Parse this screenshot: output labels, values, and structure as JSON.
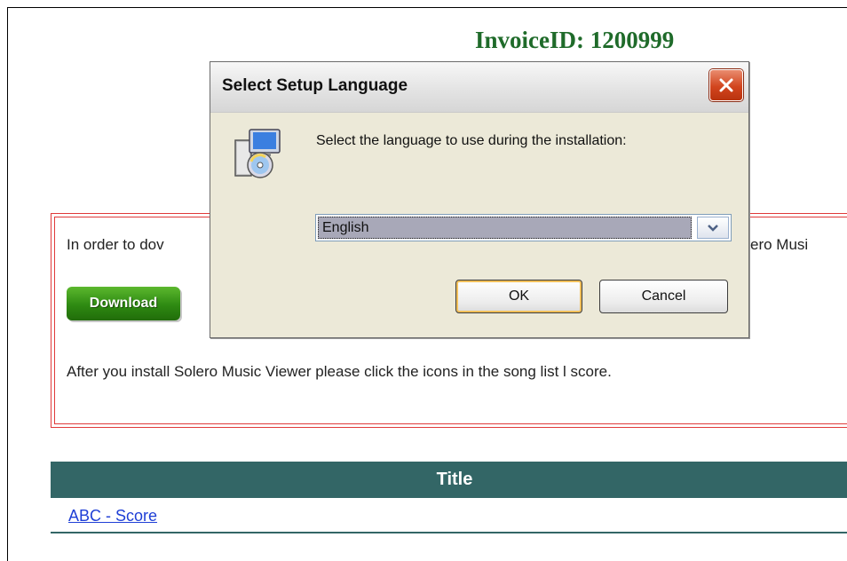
{
  "page": {
    "invoice_label": "InvoiceID: 1200999",
    "notice_line1_start": "In order to dov",
    "notice_line1_end": "ero Musi",
    "download_label": "Download",
    "notice_line2": "After you install Solero Music Viewer please click the icons in the song list l score.",
    "table": {
      "header": "Title",
      "rows": [
        {
          "link": "ABC - Score"
        }
      ]
    }
  },
  "dialog": {
    "title": "Select Setup Language",
    "prompt": "Select the language to use during the installation:",
    "select_value": "English",
    "ok_label": "OK",
    "cancel_label": "Cancel",
    "icons": {
      "close": "close-icon",
      "setup": "setup-installer-icon",
      "dropdown": "chevron-down-icon"
    }
  },
  "colors": {
    "invoice": "#1f6b2a",
    "notice_border": "#e03a3a",
    "table_header": "#336666",
    "link": "#1f3fd6",
    "close_button": "#d2451e"
  }
}
